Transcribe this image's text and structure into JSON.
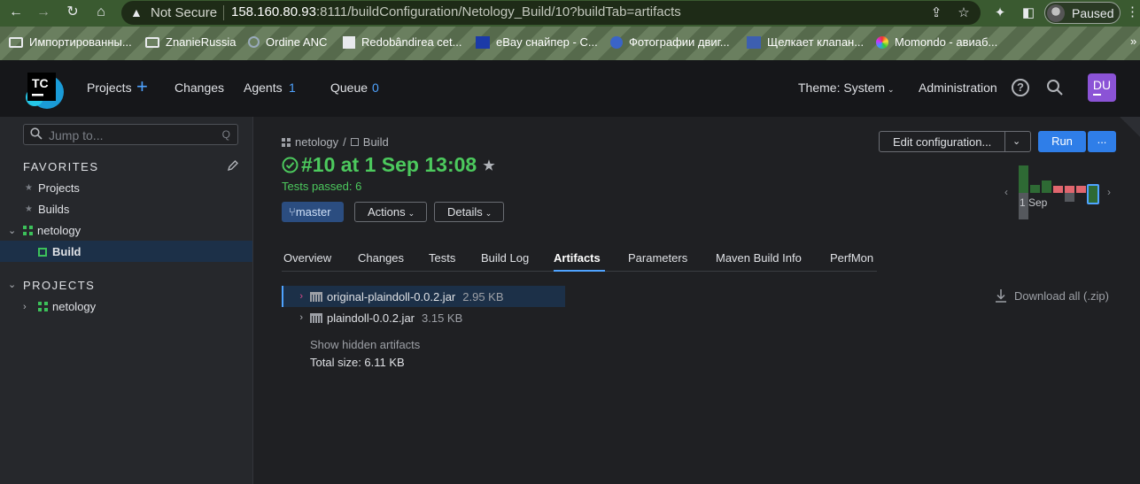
{
  "browser": {
    "security_label": "Not Secure",
    "url_host": "158.160.80.93",
    "url_rest": ":8111/buildConfiguration/Netology_Build/10?buildTab=artifacts",
    "profile_label": "Paused"
  },
  "bookmarks": [
    {
      "label": "Импортированны..."
    },
    {
      "label": "ZnanieRussia"
    },
    {
      "label": "Ordine ANC"
    },
    {
      "label": "Redobândirea cet..."
    },
    {
      "label": "eBay снайпер - C..."
    },
    {
      "label": "Фотографии двиг..."
    },
    {
      "label": "Щелкает клапан..."
    },
    {
      "label": "Momondo - авиаб..."
    }
  ],
  "bookmarks_more": "»",
  "header": {
    "logo_text": "TC",
    "projects": "Projects",
    "changes": "Changes",
    "agents": "Agents",
    "agents_count": "1",
    "queue": "Queue",
    "queue_count": "0",
    "theme": "Theme: System",
    "administration": "Administration",
    "help_symbol": "?",
    "user_initials": "DU"
  },
  "sidebar": {
    "jump_placeholder": "Jump to...",
    "jump_shortcut": "Q",
    "favorites_title": "FAVORITES",
    "favorites": [
      "Projects",
      "Builds"
    ],
    "fav_project": "netology",
    "fav_build": "Build",
    "projects_title": "PROJECTS",
    "project": "netology"
  },
  "build": {
    "breadcrumb_project": "netology",
    "breadcrumb_sep": "/",
    "breadcrumb_build": "Build",
    "title": "#10 at 1 Sep 13:08",
    "tests_status": "Tests passed: 6",
    "branch": "master",
    "actions": "Actions",
    "details": "Details",
    "edit_config": "Edit configuration...",
    "run": "Run",
    "more": "...",
    "chart_date": "1 Sep"
  },
  "tabs": [
    "Overview",
    "Changes",
    "Tests",
    "Build Log",
    "Artifacts",
    "Parameters",
    "Maven Build Info",
    "PerfMon"
  ],
  "active_tab": "Artifacts",
  "artifacts": [
    {
      "name": "original-plaindoll-0.0.2.jar",
      "size": "2.95 KB"
    },
    {
      "name": "plaindoll-0.0.2.jar",
      "size": "3.15 KB"
    }
  ],
  "show_hidden": "Show hidden artifacts",
  "total_size": "Total size: 6.11 KB",
  "download_all": "Download all (.zip)",
  "colors": {
    "success": "#4cc95d",
    "accent": "#2f7ee8",
    "failed_bar": "#e0666e"
  }
}
